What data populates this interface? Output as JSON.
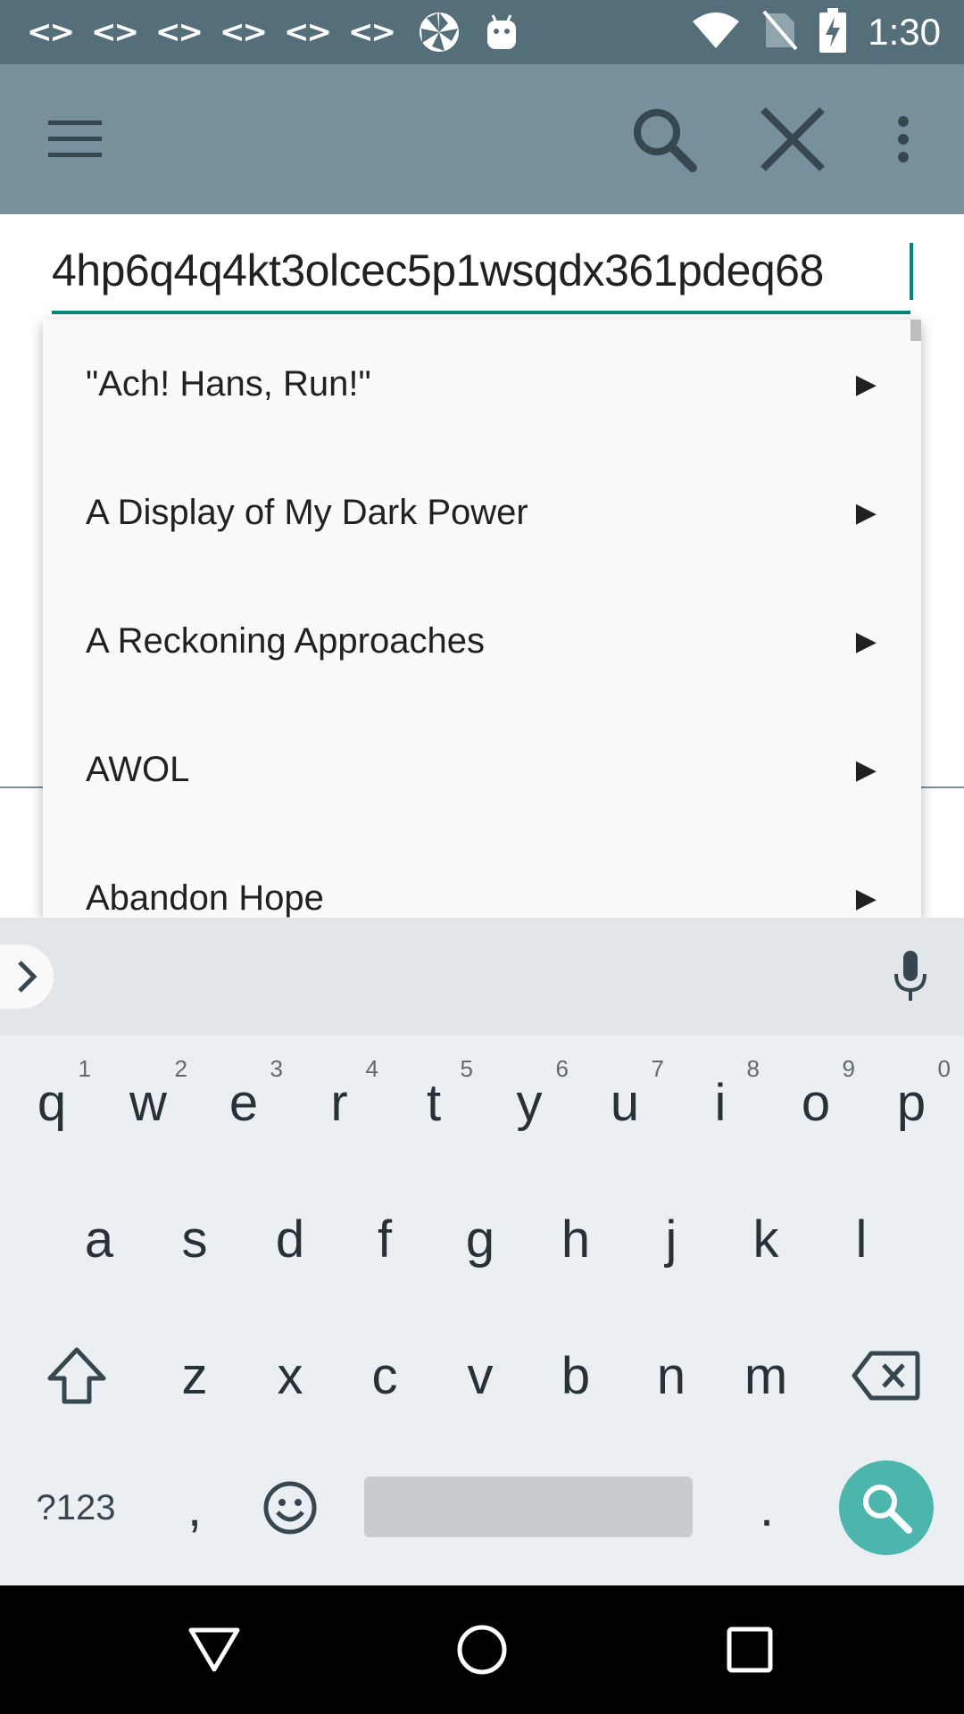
{
  "status_bar": {
    "notification_icons": [
      "code-icon",
      "code-icon",
      "code-icon",
      "code-icon",
      "code-icon",
      "code-icon",
      "pinwheel-icon",
      "android-icon"
    ],
    "code_glyph": "<>",
    "time": "1:30"
  },
  "toolbar": {
    "menu_icon": "hamburger-menu-icon",
    "search_icon": "search-icon",
    "close_icon": "close-icon",
    "overflow_icon": "more-vert-icon"
  },
  "search": {
    "value": "4hp6q4q4kt3olcec5p1wsqdx361pdeq68"
  },
  "suggestions": {
    "items": [
      {
        "label": "\"Ach! Hans, Run!\"",
        "arrow": "▶"
      },
      {
        "label": "A Display of My Dark Power",
        "arrow": "▶"
      },
      {
        "label": "A Reckoning Approaches",
        "arrow": "▶"
      },
      {
        "label": "AWOL",
        "arrow": "▶"
      },
      {
        "label": "Abandon Hope",
        "arrow": "▶"
      }
    ]
  },
  "keyboard": {
    "row1": [
      {
        "key": "q",
        "hint": "1"
      },
      {
        "key": "w",
        "hint": "2"
      },
      {
        "key": "e",
        "hint": "3"
      },
      {
        "key": "r",
        "hint": "4"
      },
      {
        "key": "t",
        "hint": "5"
      },
      {
        "key": "y",
        "hint": "6"
      },
      {
        "key": "u",
        "hint": "7"
      },
      {
        "key": "i",
        "hint": "8"
      },
      {
        "key": "o",
        "hint": "9"
      },
      {
        "key": "p",
        "hint": "0"
      }
    ],
    "row2": [
      "a",
      "s",
      "d",
      "f",
      "g",
      "h",
      "j",
      "k",
      "l"
    ],
    "row3": [
      "z",
      "x",
      "c",
      "v",
      "b",
      "n",
      "m"
    ],
    "symbols_label": "?123",
    "comma_label": ",",
    "period_label": ".",
    "accent_color": "#4db6ac"
  },
  "colors": {
    "status_bar": "#546e7a",
    "toolbar": "#78909c",
    "accent": "#00897b"
  }
}
